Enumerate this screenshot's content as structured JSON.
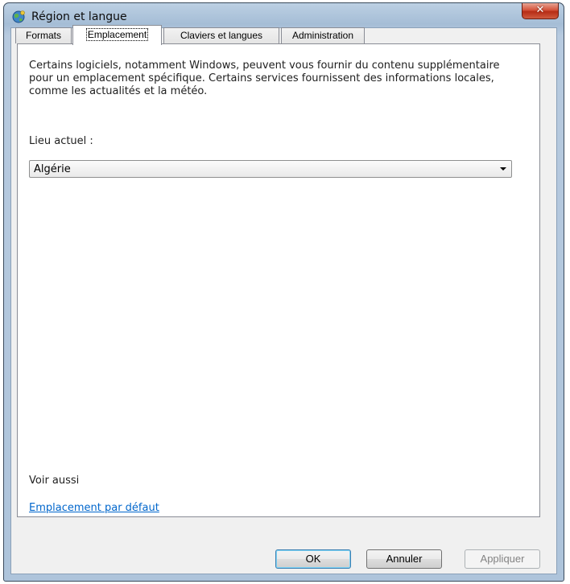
{
  "window": {
    "title": "Région et langue",
    "close_glyph": "✕"
  },
  "tabs": [
    {
      "label": "Formats",
      "active": false
    },
    {
      "label": "Emplacement",
      "active": true
    },
    {
      "label": "Claviers et langues",
      "active": false
    },
    {
      "label": "Administration",
      "active": false
    }
  ],
  "panel": {
    "description": "Certains logiciels, notamment Windows, peuvent vous fournir du contenu supplémentaire pour un emplacement spécifique. Certains services fournissent des informations locales, comme les actualités et la météo.",
    "location_label": "Lieu actuel :",
    "location_value": "Algérie",
    "see_also_label": "Voir aussi",
    "default_location_link": "Emplacement par défaut"
  },
  "buttons": {
    "ok": "OK",
    "cancel": "Annuler",
    "apply": "Appliquer"
  },
  "colors": {
    "link": "#0066cc",
    "close_button": "#c6402a",
    "title_bar": "#a9c0d8"
  },
  "icons": {
    "title_icon": "globe-icon",
    "close": "close-icon",
    "dropdown": "chevron-down-icon"
  }
}
